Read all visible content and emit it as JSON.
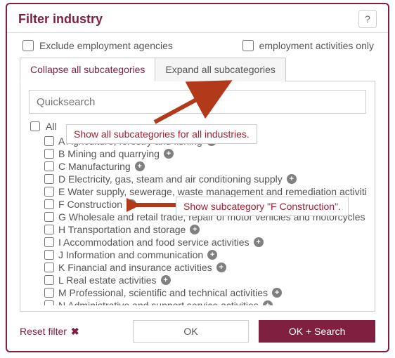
{
  "header": {
    "title": "Filter industry",
    "help": "?"
  },
  "options": {
    "exclude_label": "Exclude employment agencies",
    "only_label": "employment activities only"
  },
  "tabs": {
    "collapse": "Collapse all subcategories",
    "expand": "Expand all subcategories"
  },
  "search": {
    "placeholder": "Quicksearch"
  },
  "all_label": "All",
  "items": [
    "A Agriculture, forestry and fishing",
    "B Mining and quarrying",
    "C Manufacturing",
    "D Electricity, gas, steam and air conditioning supply",
    "E Water supply, sewerage, waste management and remediation activities",
    "F Construction",
    "G Wholesale and retail trade; repair of motor vehicles and motorcycles",
    "H Transportation and storage",
    "I Accommodation and food service activities",
    "J Information and communication",
    "K Financial and insurance activities",
    "L Real estate activities",
    "M Professional, scientific and technical activities",
    "N Administrative and support service activities"
  ],
  "footer": {
    "reset": "Reset filter",
    "ok": "OK",
    "ok_search": "OK + Search"
  },
  "annotations": {
    "a1": "Show all subcategories for all industries.",
    "a2": "Show subcategory \"F Construction\"."
  }
}
